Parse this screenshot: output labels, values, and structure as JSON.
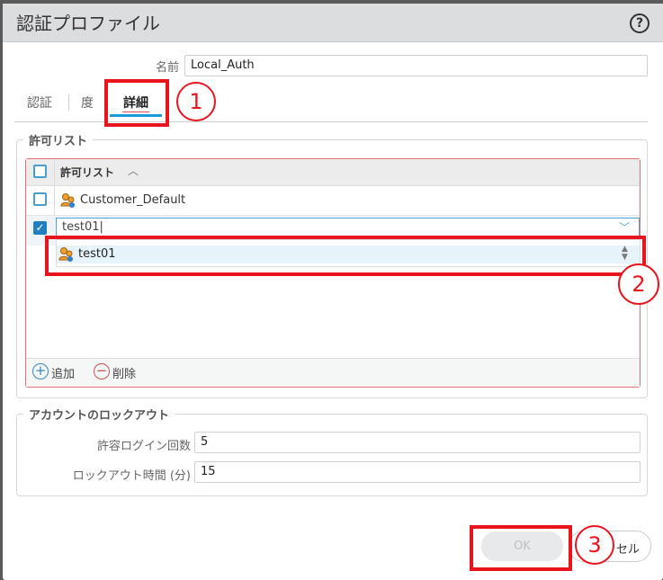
{
  "dialog": {
    "title": "認証プロファイル",
    "help_icon": "?"
  },
  "name": {
    "label": "名前",
    "value": "Local_Auth"
  },
  "tabs": [
    {
      "label": "認証"
    },
    {
      "label": "度"
    },
    {
      "label": "詳細",
      "active": true
    }
  ],
  "allow_list": {
    "legend": "許可リスト",
    "column_header": "許可リスト",
    "rows": [
      {
        "name": "Customer_Default",
        "checked": false
      },
      {
        "name": "test01",
        "checked": true,
        "editing": true
      }
    ],
    "dropdown_options": [
      "test01"
    ],
    "add_label": "追加",
    "delete_label": "削除"
  },
  "lockout": {
    "legend": "アカウントのロックアウト",
    "failed_attempts_label": "許容ログイン回数",
    "failed_attempts": "5",
    "lockout_time_label": "ロックアウト時間 (分)",
    "lockout_time": "15"
  },
  "buttons": {
    "ok": "OK",
    "cancel": "セル"
  },
  "annotations": [
    "1",
    "2",
    "3"
  ],
  "colors": {
    "annotation": "#e8141e",
    "accent": "#1a9ad6"
  }
}
